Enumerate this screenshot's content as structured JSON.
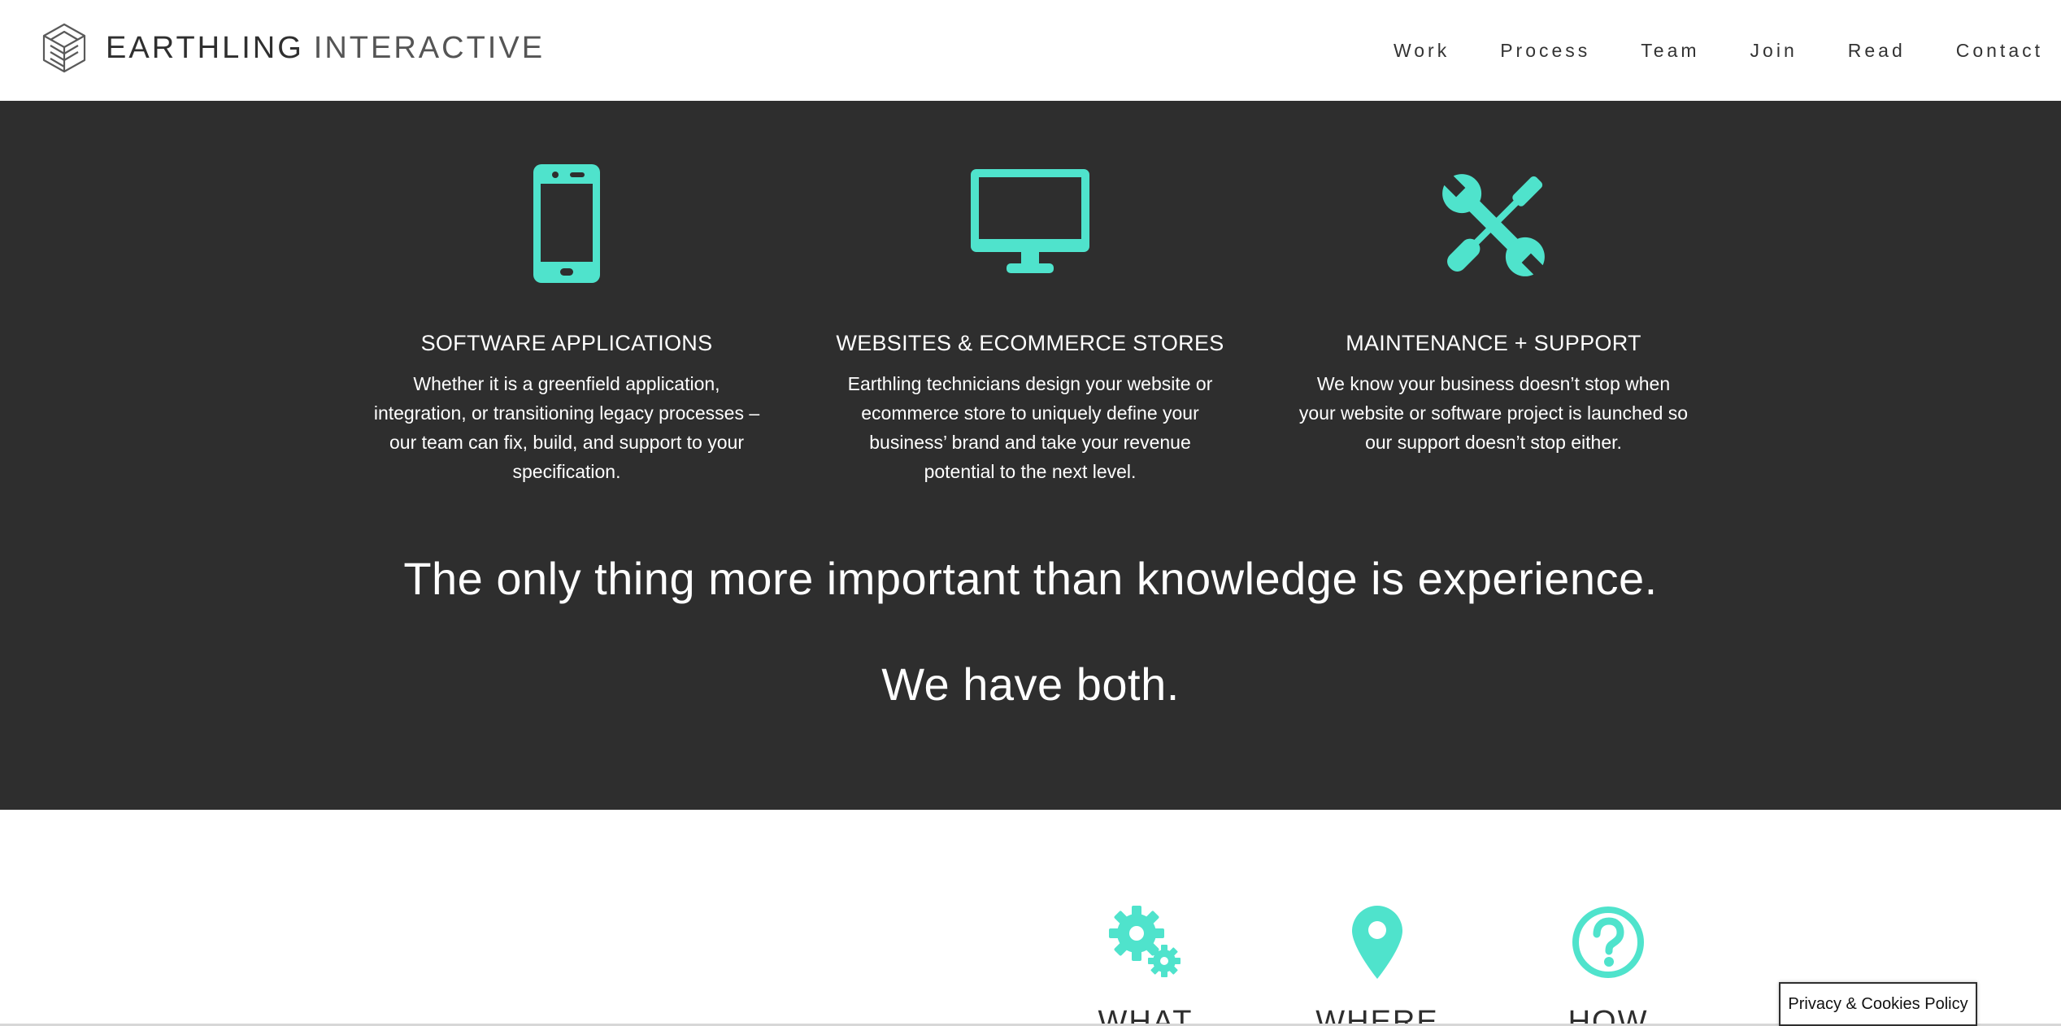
{
  "brand": {
    "name_primary": "EARTHLING",
    "name_secondary": "INTERACTIVE"
  },
  "nav": {
    "items": [
      {
        "label": "Work"
      },
      {
        "label": "Process"
      },
      {
        "label": "Team"
      },
      {
        "label": "Join"
      },
      {
        "label": "Read"
      },
      {
        "label": "Contact"
      }
    ]
  },
  "services": [
    {
      "icon": "smartphone-icon",
      "title": "SOFTWARE APPLICATIONS",
      "description": "Whether it is a greenfield application, integration, or transitioning legacy processes – our team can fix, build, and support to your specification."
    },
    {
      "icon": "monitor-icon",
      "title": "WEBSITES & ECOMMERCE STORES",
      "description": "Earthling technicians design your website or ecommerce store to uniquely define your business’ brand and take your revenue potential to the next level."
    },
    {
      "icon": "tools-icon",
      "title": "MAINTENANCE + SUPPORT",
      "description": "We know your business doesn’t stop when your website or software project is launched so our support doesn’t stop either."
    }
  ],
  "quote": {
    "line1": "The only thing more important than knowledge is experience.",
    "line2": "We have both."
  },
  "features": [
    {
      "icon": "gears-icon",
      "label": "WHAT"
    },
    {
      "icon": "map-pin-icon",
      "label": "WHERE"
    },
    {
      "icon": "question-icon",
      "label": "HOW"
    }
  ],
  "cookie": {
    "label": "Privacy & Cookies Policy"
  },
  "colors": {
    "accent": "#4fe3cc",
    "dark_bg": "#2e2e2e",
    "text_light": "#ffffff",
    "text_dark": "#333333"
  }
}
